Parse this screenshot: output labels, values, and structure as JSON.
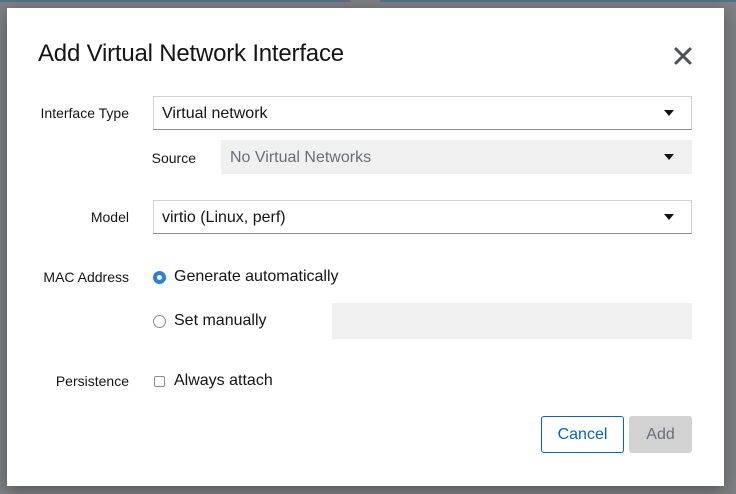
{
  "dialog": {
    "title": "Add Virtual Network Interface",
    "close_icon": "close-icon"
  },
  "interface_type": {
    "label": "Interface Type",
    "value": "Virtual network"
  },
  "source": {
    "label": "Source",
    "value": "No Virtual Networks",
    "disabled": true
  },
  "model": {
    "label": "Model",
    "value": "virtio (Linux, perf)"
  },
  "mac_address": {
    "label": "MAC Address",
    "option_auto": "Generate automatically",
    "option_manual": "Set manually",
    "selected": "auto",
    "manual_value": ""
  },
  "persistence": {
    "label": "Persistence",
    "checkbox_label": "Always attach",
    "checked": false
  },
  "footer": {
    "cancel_label": "Cancel",
    "add_label": "Add"
  },
  "colors": {
    "primary": "#0066cc",
    "radio_checked": "#2b7de9",
    "disabled_bg": "#f0f0f0",
    "overlay": "#7e8184"
  }
}
